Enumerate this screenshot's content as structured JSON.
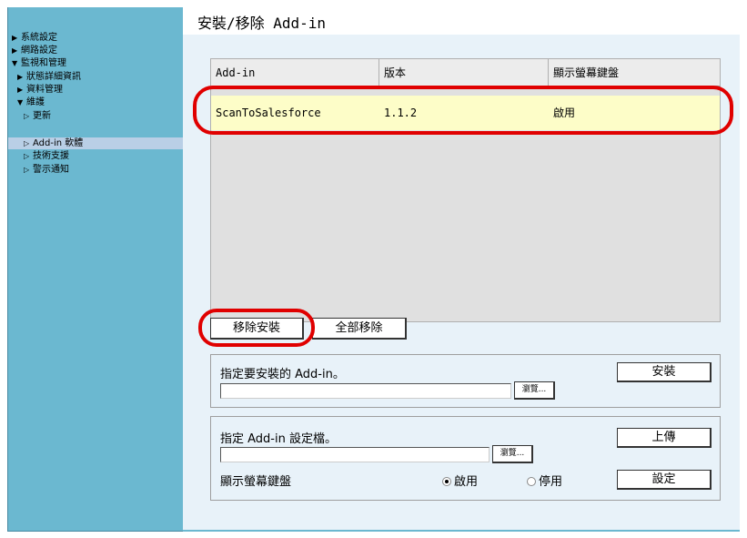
{
  "sidebar": {
    "items": [
      {
        "icon": "▶",
        "label": "系統設定"
      },
      {
        "icon": "▶",
        "label": "網路設定"
      },
      {
        "icon": "▼",
        "label": "監視和管理"
      },
      {
        "icon": "▶",
        "label": "狀態詳細資訊"
      },
      {
        "icon": "▶",
        "label": "資料管理"
      },
      {
        "icon": "▼",
        "label": "維護"
      },
      {
        "icon": "▷",
        "label": "更新"
      },
      {
        "icon": "▷",
        "label": "Add-in 軟體"
      },
      {
        "icon": "▷",
        "label": "技術支援"
      },
      {
        "icon": "▷",
        "label": "警示通知"
      }
    ]
  },
  "page": {
    "title": "安裝/移除 Add-in"
  },
  "list": {
    "columns": [
      "Add-in",
      "版本",
      "顯示螢幕鍵盤"
    ],
    "rows": [
      {
        "name": "ScanToSalesforce",
        "version": "1.1.2",
        "keyboard": "啟用"
      }
    ]
  },
  "actions": {
    "remove": "移除安裝",
    "remove_all": "全部移除"
  },
  "install": {
    "label": "指定要安裝的 Add-in。",
    "file_value": "",
    "browse": "瀏覽...",
    "button": "安裝"
  },
  "settings": {
    "label": "指定 Add-in 設定檔。",
    "file_value": "",
    "browse": "瀏覽...",
    "upload": "上傳",
    "keyboard_label": "顯示螢幕鍵盤",
    "enable": "啟用",
    "disable": "停用",
    "selected": "enable",
    "set_button": "設定"
  },
  "colors": {
    "sidebar_bg": "#6bb8d0",
    "main_bg": "#e8f2f9",
    "row_highlight": "#fdfdc8",
    "annotation_red": "#e00000"
  }
}
